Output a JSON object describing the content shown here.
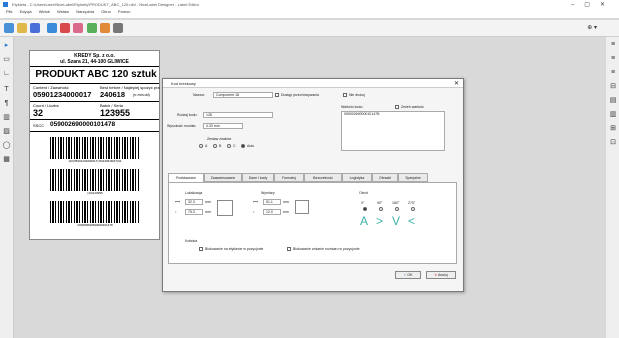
{
  "window": {
    "title": "Etykieta - C:\\Users\\user\\NiceLabel\\Etykiety\\PRODUKT_ABC_120.nlbl - NiceLabel Designer - Label Editor",
    "menu": [
      "Plik",
      "Edycja",
      "Widok",
      "Wstaw",
      "Narzędzia",
      "Okno",
      "Pomoc"
    ],
    "zoom_label": "⊕ ▾"
  },
  "label": {
    "company": "KREDY Sp. z o.o.",
    "address": "ul. Szara 21, 44-100 GLIWICE",
    "product": "PRODUKT ABC 120 sztuk",
    "content_label": "Content / Zawartość",
    "content_value": "05901234000017",
    "best_before_label": "Best before / Najlepiej spożyć przed",
    "best_before_value": "240618",
    "best_before_suffix": "(rr-mm-dd)",
    "count_label": "Count / Liczba",
    "count_value": "32",
    "batch_label": "Batch / Seria",
    "batch_value": "123955",
    "sscc_label": "SSCC",
    "sscc_value": "059002690000101478",
    "barcode1_text": "(02)05901234000017(15)240618(37)32",
    "barcode2_text": "(10)123955",
    "barcode3_text": "(00)059002690000101478"
  },
  "dialog": {
    "title": "Kod kreskowy",
    "name_label": "Nazwa:",
    "name_value": "Component 18",
    "use_as_data_label": "Dostęp przechowywania",
    "print_label": "Nie drukuj",
    "type_label": "Rodzaj kodu:",
    "type_value": "128",
    "size_label": "Wysokość modułu:",
    "size_value": "0.33 mm",
    "content_box_label": "Wartość kodu:",
    "content_box_value": "05900269000010147B",
    "auto_label": "Zmień wartość",
    "number_system_label": "Zestaw znaków",
    "radios": [
      "A",
      "B",
      "C",
      "Auto"
    ],
    "tabs": [
      "Podstawowe",
      "Zaawansowane",
      "Dane i kody",
      "Formatuj",
      "Bezczelność",
      "Logistyka",
      "Obrazki",
      "Specjalne"
    ],
    "position_label": "Lokalizacja",
    "pos_x": "32.3",
    "pos_y": "75.3",
    "unit": "mm",
    "size_group_label": "Wymiary",
    "width": "51.1",
    "height": "12.0",
    "rotation_label": "Obrót",
    "rotation_options": [
      "0°",
      "90°",
      "180°",
      "270°"
    ],
    "anchor_label": "Kotwica",
    "lock_position": "Blokowanie na etykiecie w pozycjonie",
    "lock_size": "Blokowanie zmianie rozmiaru w pozycjonie",
    "ok": "OK",
    "cancel": "Anuluj"
  },
  "colors": {
    "accent": "#3bb0a8",
    "titlebar_icon": "#2a7ad8"
  }
}
